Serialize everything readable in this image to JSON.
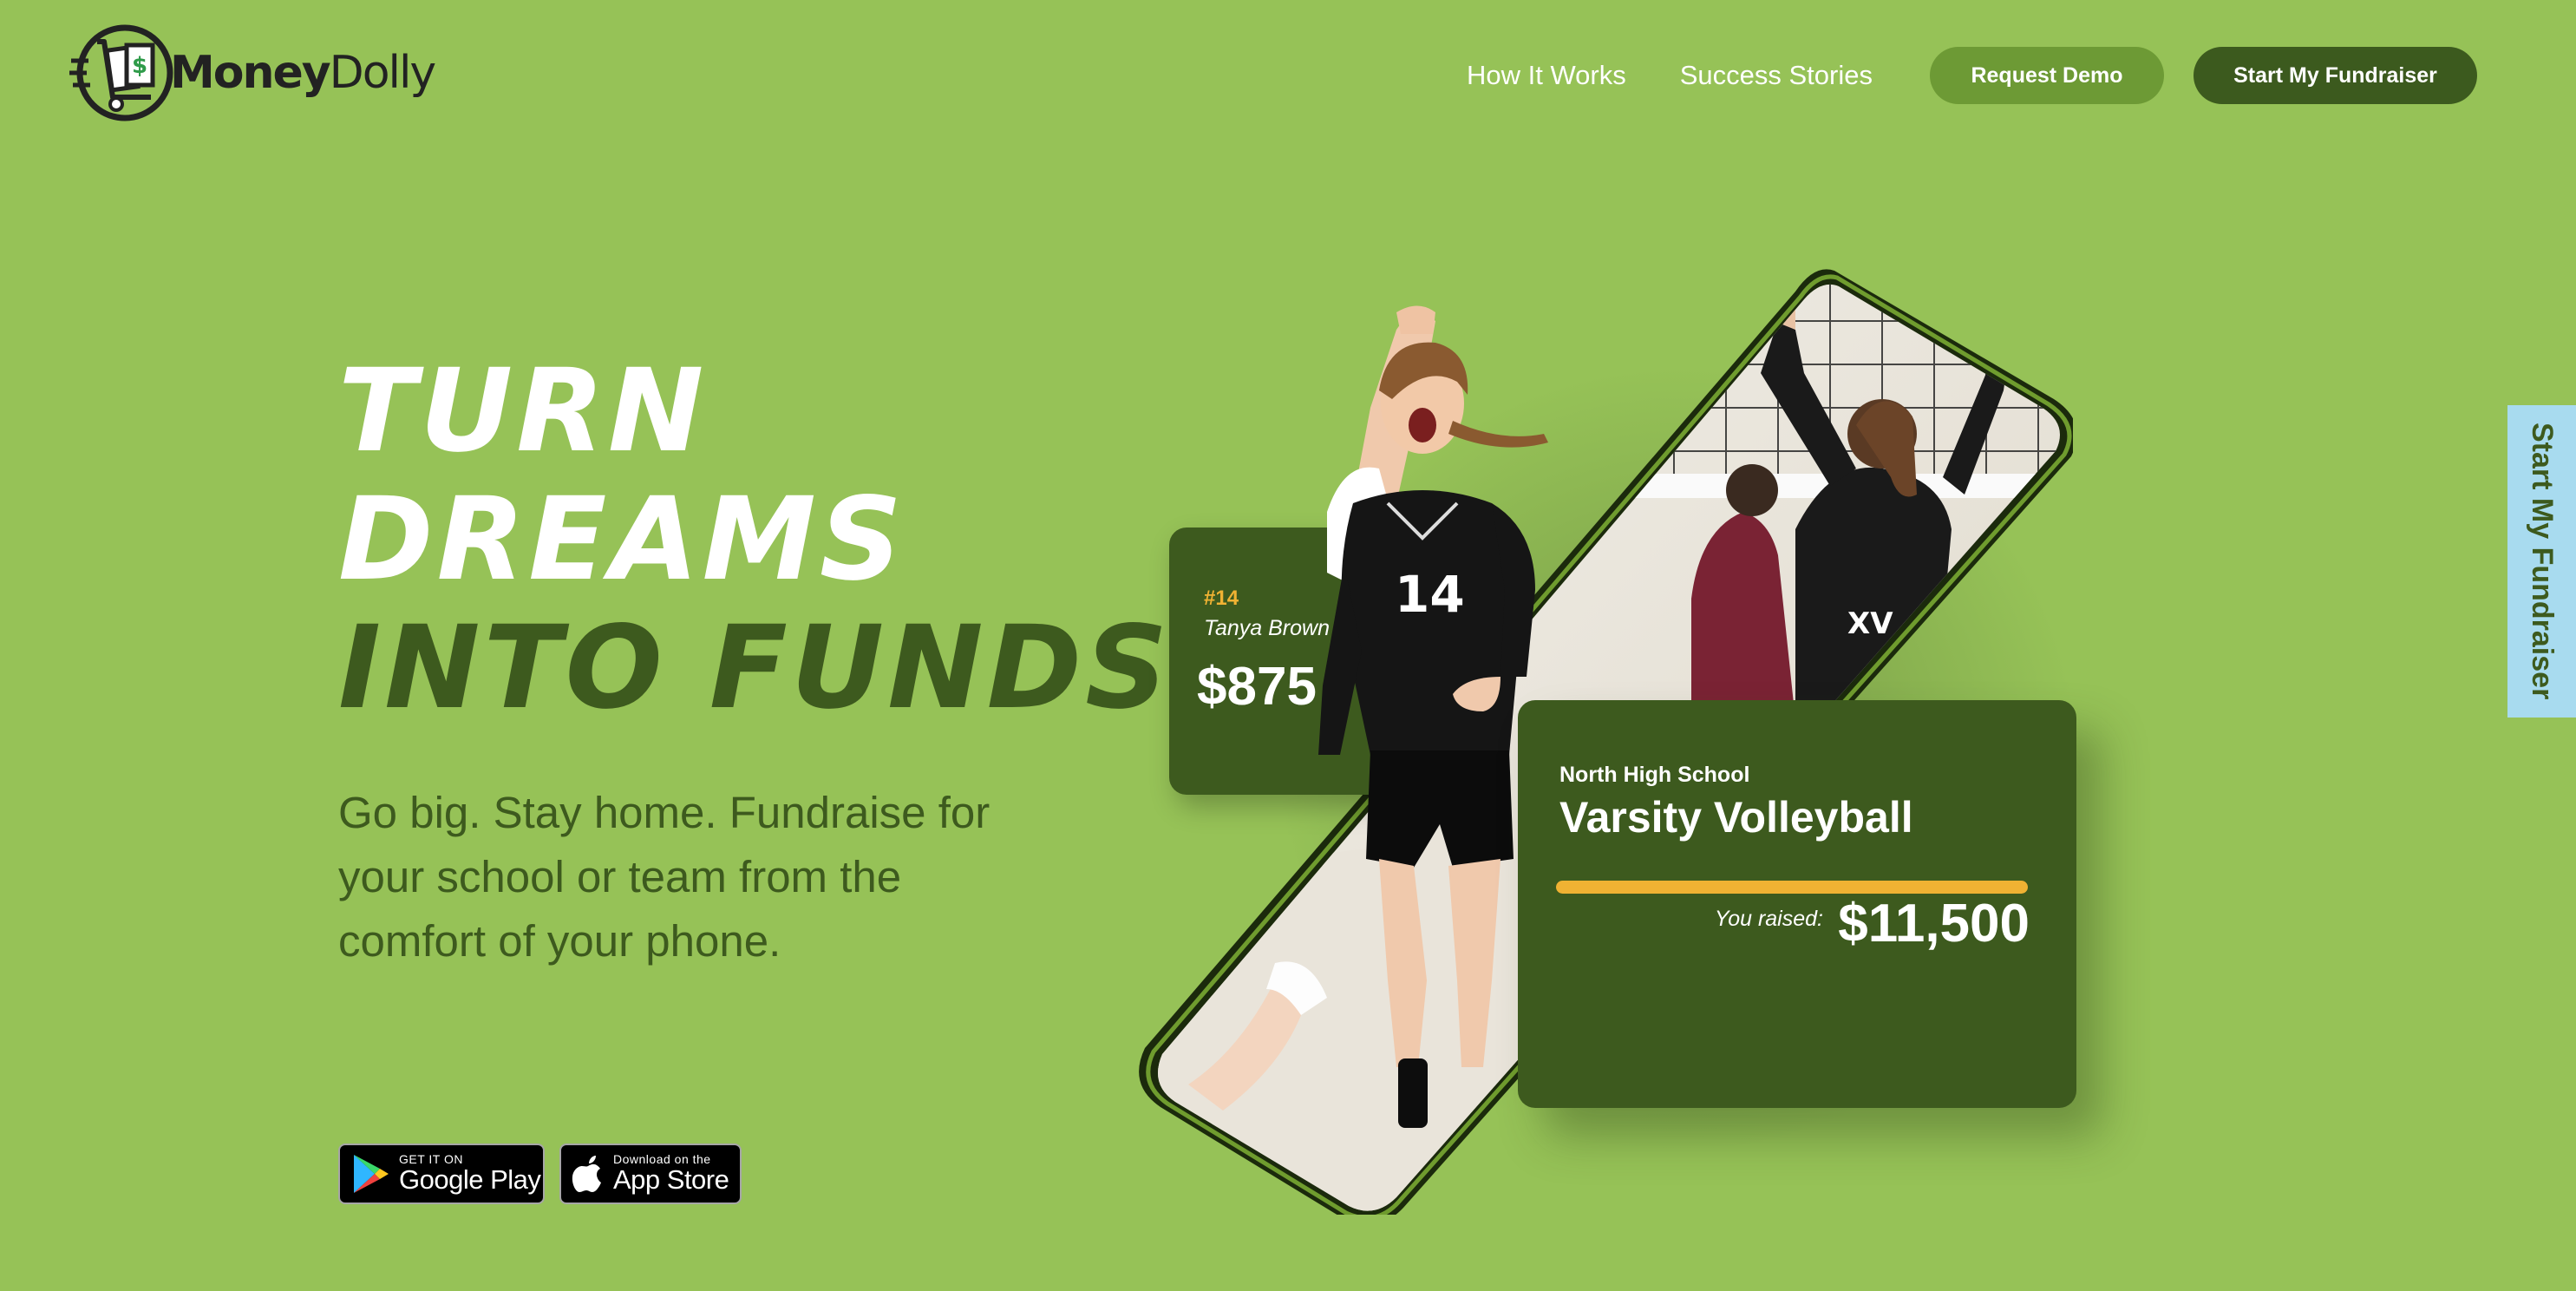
{
  "brand": {
    "name_bold": "Money",
    "name_regular": "Dolly",
    "logo_icon": "money-dolly-cart-icon"
  },
  "nav": {
    "links": [
      {
        "label": "How It Works"
      },
      {
        "label": "Success Stories"
      }
    ],
    "request_demo_label": "Request Demo",
    "start_fundraiser_label": "Start My Fundraiser"
  },
  "hero": {
    "headline_line1": "Turn",
    "headline_line2": "Dreams",
    "headline_line3": "Into Funds",
    "subtitle": "Go big. Stay home. Fundraise for your school or team from the comfort of your phone."
  },
  "stores": {
    "google_play": {
      "small": "GET IT ON",
      "big": "Google Play",
      "icon": "google-play-icon"
    },
    "app_store": {
      "small": "Download on the",
      "big": "App Store",
      "icon": "apple-icon"
    }
  },
  "player_card": {
    "number": "#14",
    "name": "Tanya Brown",
    "amount": "$875",
    "jersey": "14"
  },
  "team_card": {
    "school": "North High School",
    "team": "Varsity Volleyball",
    "raised_label": "You raised:",
    "raised_amount": "$11,500",
    "progress_percent": 100
  },
  "side_tab": {
    "label": "Start My Fundraiser"
  },
  "colors": {
    "background": "#96c257",
    "dark_green": "#3d5a1e",
    "mid_green": "#6d9a35",
    "accent_gold": "#f0b233",
    "side_tab": "#a8dbef"
  }
}
